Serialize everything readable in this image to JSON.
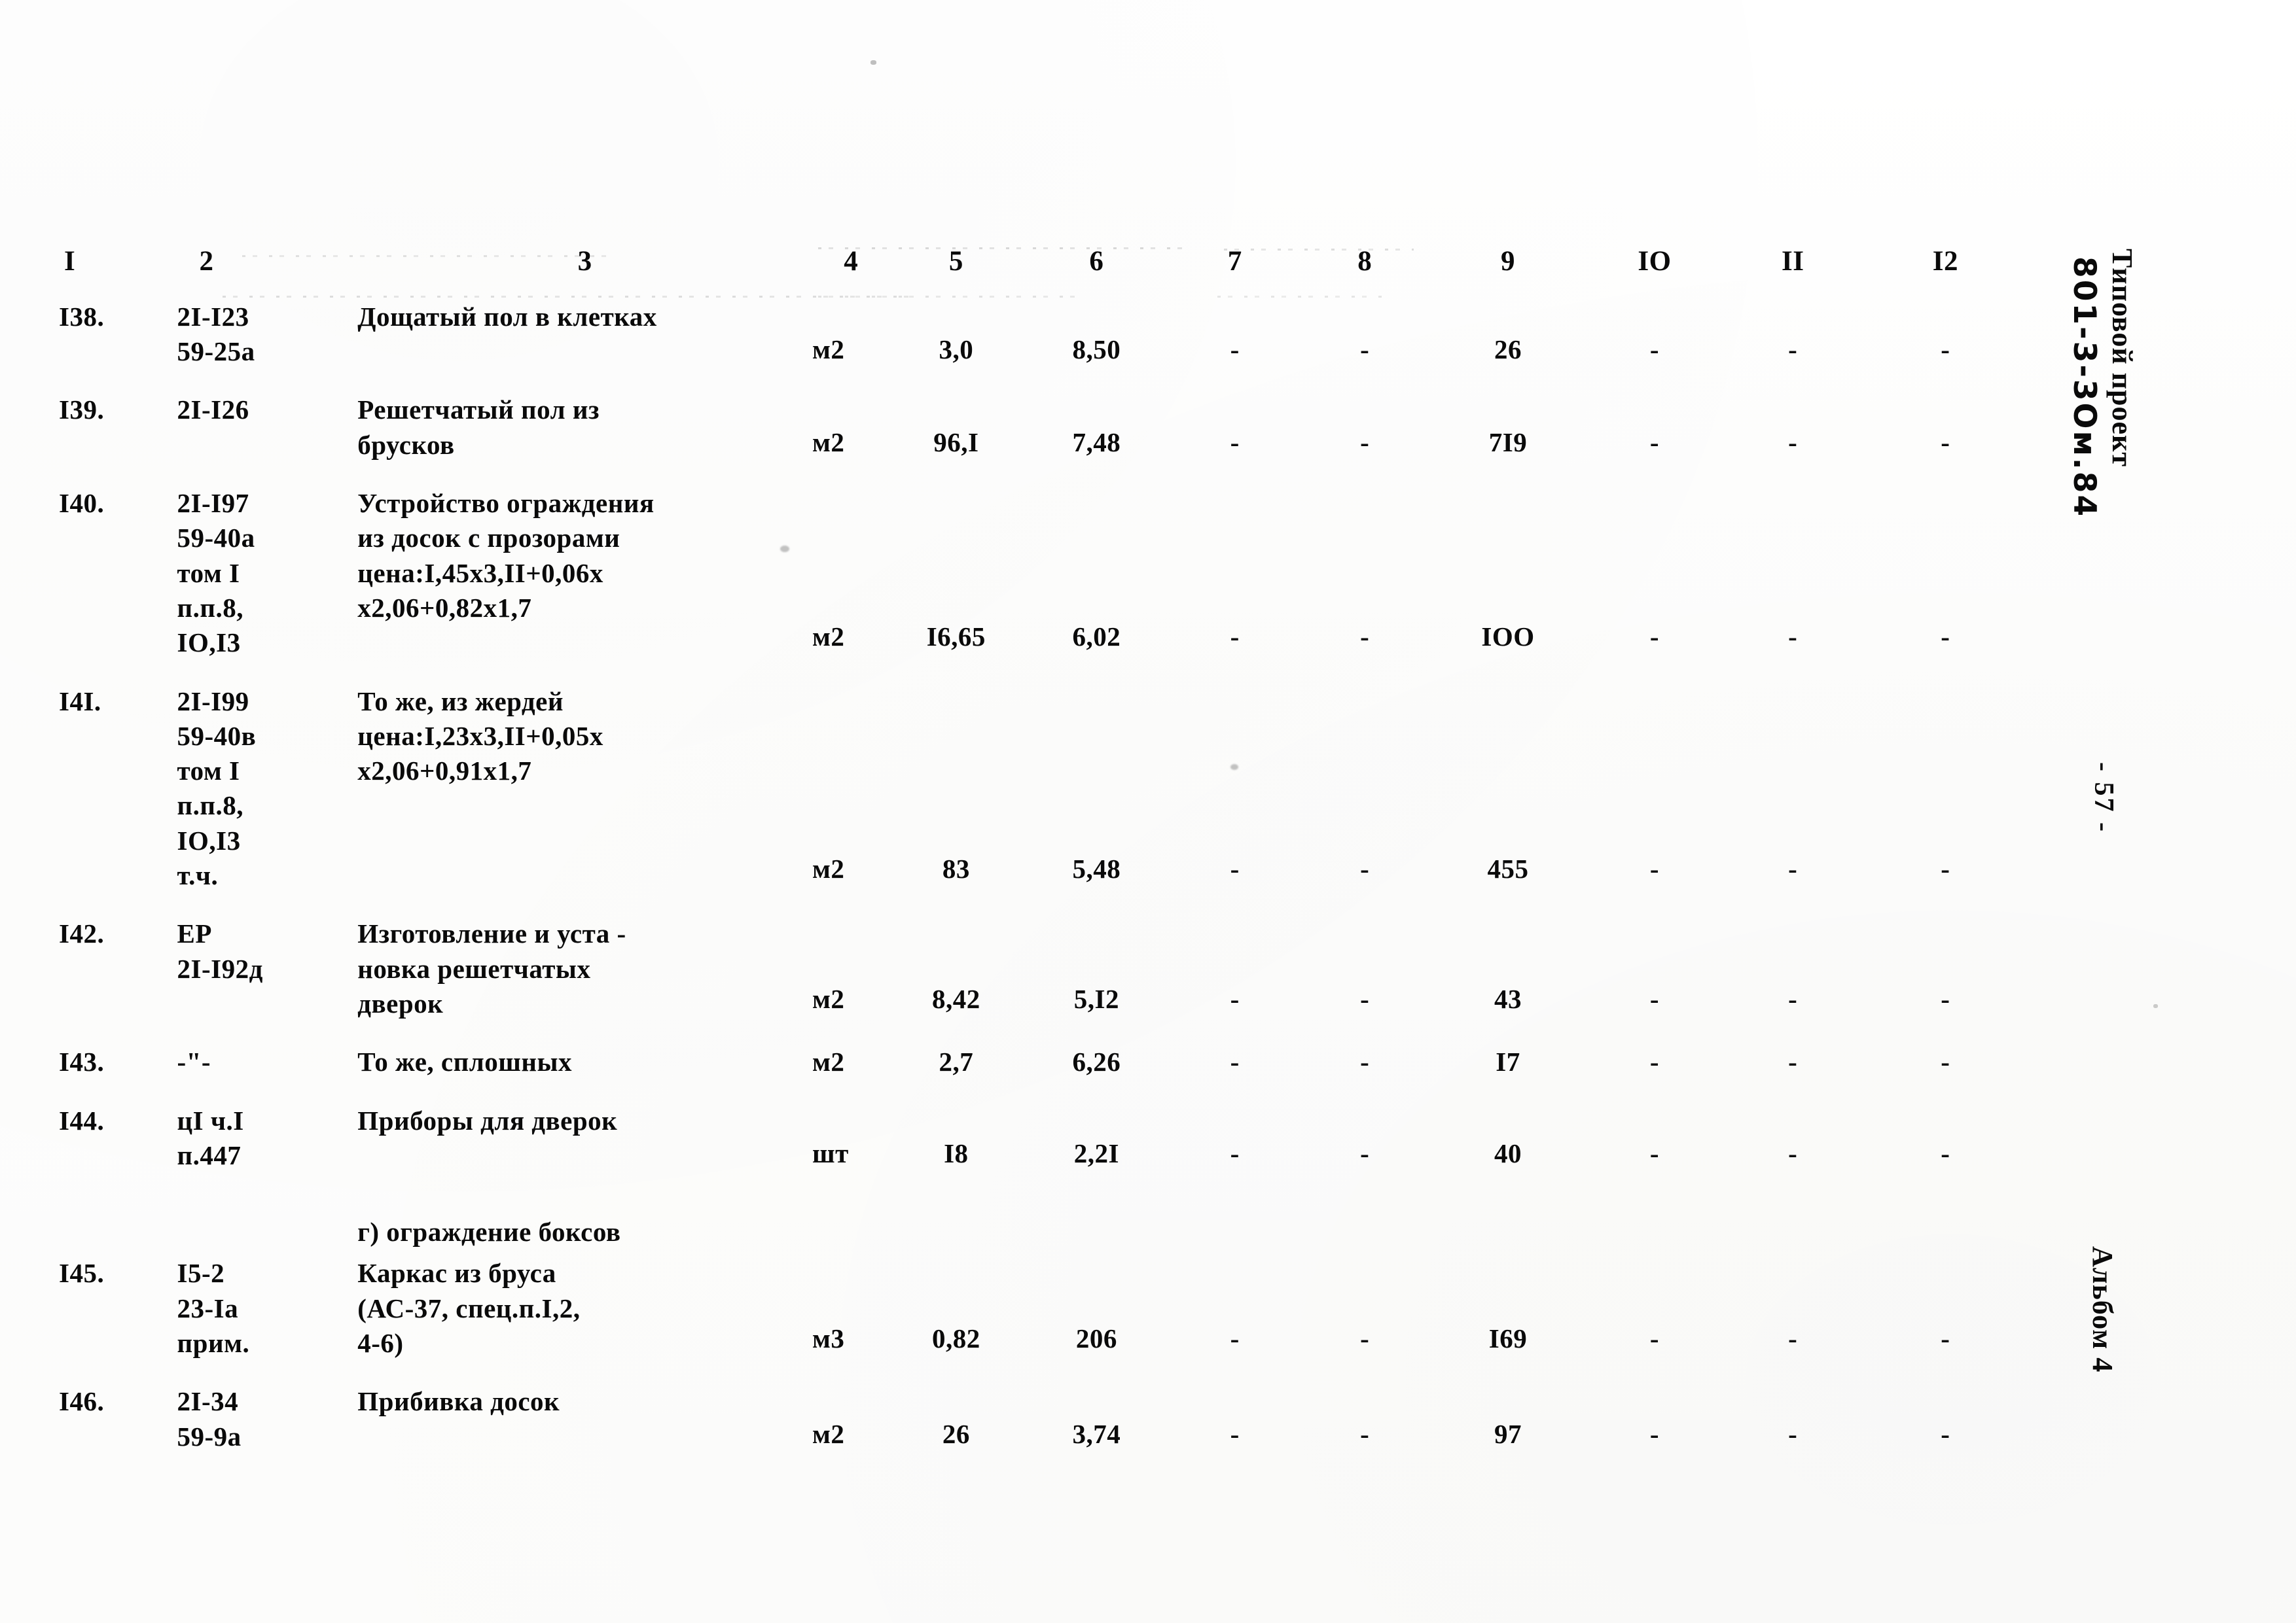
{
  "document": {
    "margin_notes": {
      "project_label": "Типовой проект",
      "project_code_handwritten": "801-3-3Ом.84",
      "page_number": "- 57 -",
      "album": "Альбом 4"
    }
  },
  "table": {
    "column_headers": [
      "I",
      "2",
      "3",
      "4",
      "5",
      "6",
      "7",
      "8",
      "9",
      "IO",
      "II",
      "I2"
    ],
    "dash": "-",
    "rows": [
      {
        "kind": "item",
        "num": "I38.",
        "code_lines": [
          "2I-I23",
          "59-25а"
        ],
        "desc_lines": [
          "Дощатый пол в клетках"
        ],
        "unit": "м2",
        "qty": "3,0",
        "price": "8,50",
        "c7": "-",
        "c8": "-",
        "c9": "26",
        "c10": "-",
        "c11": "-",
        "c12": "-",
        "num_offset": 1
      },
      {
        "kind": "item",
        "num": "I39.",
        "code_lines": [
          "2I-I26"
        ],
        "desc_lines": [
          "Решетчатый пол из",
          "брусков"
        ],
        "unit": "м2",
        "qty": "96,I",
        "price": "7,48",
        "c7": "-",
        "c8": "-",
        "c9": "7I9",
        "c10": "-",
        "c11": "-",
        "c12": "-",
        "num_offset": 1
      },
      {
        "kind": "item",
        "num": "I40.",
        "code_lines": [
          "2I-I97",
          "59-40а",
          "том I",
          "п.п.8,",
          "IO,I3"
        ],
        "desc_lines": [
          "Устройство ограждения",
          "из досок с прозорами",
          "",
          "цена:I,45х3,II+0,06х",
          "х2,06+0,82х1,7"
        ],
        "unit": "м2",
        "qty": "I6,65",
        "price": "6,02",
        "c7": "-",
        "c8": "-",
        "c9": "IOO",
        "c10": "-",
        "c11": "-",
        "c12": "-",
        "num_offset": 4
      },
      {
        "kind": "item",
        "num": "I4I.",
        "code_lines": [
          "2I-I99",
          "59-40в",
          "том I",
          "п.п.8,",
          "IO,I3",
          "т.ч."
        ],
        "desc_lines": [
          "То же, из жердей",
          "",
          "",
          "",
          "цена:I,23х3,II+0,05х",
          "х2,06+0,91х1,7"
        ],
        "unit": "м2",
        "qty": "83",
        "price": "5,48",
        "c7": "-",
        "c8": "-",
        "c9": "455",
        "c10": "-",
        "c11": "-",
        "c12": "-",
        "num_offset": 5
      },
      {
        "kind": "item",
        "num": "I42.",
        "code_lines": [
          "ЕР",
          "2I-I92д"
        ],
        "desc_lines": [
          "Изготовление и уста -",
          "новка решетчатых",
          "дверок"
        ],
        "unit": "м2",
        "qty": "8,42",
        "price": "5,I2",
        "c7": "-",
        "c8": "-",
        "c9": "43",
        "c10": "-",
        "c11": "-",
        "c12": "-",
        "num_offset": 2
      },
      {
        "kind": "item",
        "num": "I43.",
        "code_lines": [
          "-\"-"
        ],
        "desc_lines": [
          "То же, сплошных"
        ],
        "unit": "м2",
        "qty": "2,7",
        "price": "6,26",
        "c7": "-",
        "c8": "-",
        "c9": "I7",
        "c10": "-",
        "c11": "-",
        "c12": "-",
        "num_offset": 0
      },
      {
        "kind": "item",
        "num": "I44.",
        "code_lines": [
          "цI ч.I",
          "п.447"
        ],
        "desc_lines": [
          "Приборы для дверок"
        ],
        "unit": "шт",
        "qty": "I8",
        "price": "2,2I",
        "c7": "-",
        "c8": "-",
        "c9": "40",
        "c10": "-",
        "c11": "-",
        "c12": "-",
        "num_offset": 1
      },
      {
        "kind": "section",
        "title": "г) ограждение боксов"
      },
      {
        "kind": "item",
        "num": "I45.",
        "code_lines": [
          "I5-2",
          "23-Iа",
          "прим."
        ],
        "desc_lines": [
          "Каркас из бруса",
          "(АС-37, спец.п.I,2,",
          "4-6)"
        ],
        "unit": "м3",
        "qty": "0,82",
        "price": "206",
        "c7": "-",
        "c8": "-",
        "c9": "I69",
        "c10": "-",
        "c11": "-",
        "c12": "-",
        "num_offset": 2
      },
      {
        "kind": "item",
        "num": "I46.",
        "code_lines": [
          "2I-34",
          "59-9а"
        ],
        "desc_lines": [
          "Прибивка досок"
        ],
        "unit": "м2",
        "qty": "26",
        "price": "3,74",
        "c7": "-",
        "c8": "-",
        "c9": "97",
        "c10": "-",
        "c11": "-",
        "c12": "-",
        "num_offset": 1
      }
    ]
  }
}
